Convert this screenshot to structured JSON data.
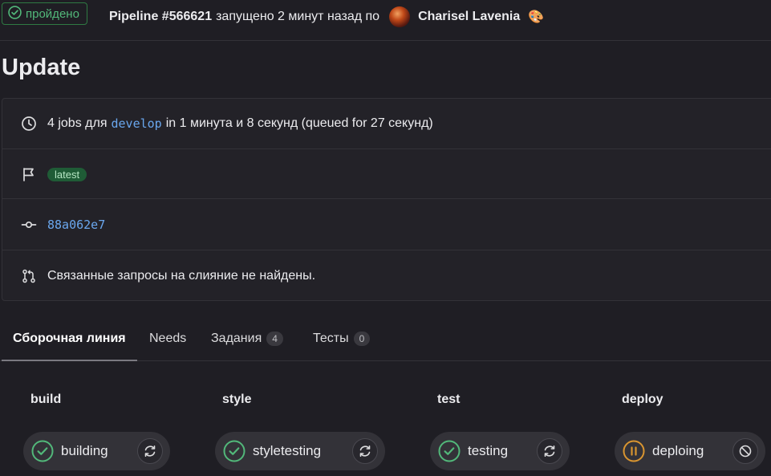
{
  "header": {
    "status": "пройдено",
    "pipeline_id": "Pipeline #566621",
    "started_text": "запущено 2 минут назад по",
    "author": "Charisel Lavenia",
    "author_emoji": "🎨"
  },
  "title": "Update",
  "info": {
    "jobs_prefix": "4 jobs для",
    "branch": "develop",
    "jobs_suffix": "in 1 минута и 8 секунд (queued for 27 секунд)",
    "tag": "latest",
    "commit": "88a062e7",
    "merge_requests": "Связанные запросы на слияние не найдены."
  },
  "tabs": [
    {
      "label": "Сборочная линия",
      "active": true
    },
    {
      "label": "Needs"
    },
    {
      "label": "Задания",
      "count": "4"
    },
    {
      "label": "Тесты",
      "count": "0"
    }
  ],
  "stages": [
    {
      "name": "build",
      "job": "building",
      "status": "passed",
      "action": "retry-icon"
    },
    {
      "name": "style",
      "job": "styletesting",
      "status": "passed",
      "action": "retry-icon"
    },
    {
      "name": "test",
      "job": "testing",
      "status": "passed",
      "action": "retry-icon"
    },
    {
      "name": "deploy",
      "job": "deploing",
      "status": "paused",
      "action": "cancel-icon"
    }
  ],
  "colors": {
    "success": "#52b87a",
    "paused": "#d99530",
    "link": "#6aa7ee",
    "background": "#1f1e24"
  }
}
